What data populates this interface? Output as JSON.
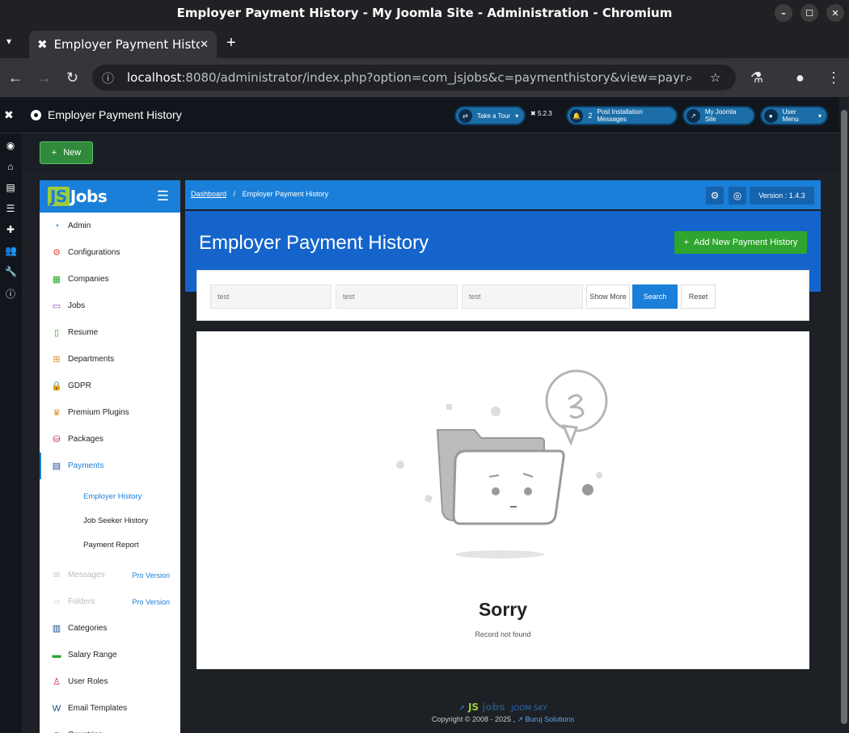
{
  "window": {
    "title": "Employer Payment History - My Joomla Site - Administration - Chromium"
  },
  "browser": {
    "tab_title": "Employer Payment History - My Joomla Site - Administration",
    "url_host": "localhost",
    "url_rest": ":8080/administrator/index.php?option=com_jsjobs&c=paymenthistory&view=paymenthistory&la..."
  },
  "joomla_header": {
    "page_title": "Employer Payment History",
    "take_tour": "Take a Tour",
    "version": "5.2.3",
    "messages_count": "2",
    "post_install": "Post Installation Messages",
    "my_site": "My Joomla Site",
    "user_menu": "User Menu"
  },
  "toolbar": {
    "new_label": "New"
  },
  "sidebar": {
    "brand": "Jobs",
    "brand_prefix": "JS",
    "items": [
      {
        "label": "Admin",
        "icon": "dashboard-icon",
        "color": "#1a7fd8"
      },
      {
        "label": "Configurations",
        "icon": "gear-icon",
        "color": "#e0503a"
      },
      {
        "label": "Companies",
        "icon": "building-icon",
        "color": "#2ea52e"
      },
      {
        "label": "Jobs",
        "icon": "briefcase-icon",
        "color": "#8a44b8"
      },
      {
        "label": "Resume",
        "icon": "resume-icon",
        "color": "#2ea52e"
      },
      {
        "label": "Departments",
        "icon": "departments-icon",
        "color": "#e08a1a"
      },
      {
        "label": "GDPR",
        "icon": "lock-icon",
        "color": "#e0a81a"
      },
      {
        "label": "Premium Plugins",
        "icon": "crown-icon",
        "color": "#e08a1a"
      },
      {
        "label": "Packages",
        "icon": "packages-icon",
        "color": "#c2185b"
      },
      {
        "label": "Payments",
        "icon": "payments-icon",
        "color": "#1a4a8a"
      }
    ],
    "sub_items": [
      {
        "label": "Employer History"
      },
      {
        "label": "Job Seeker History"
      },
      {
        "label": "Payment Report"
      }
    ],
    "items_after": [
      {
        "label": "Messages",
        "icon": "mail-icon",
        "pro": "Pro Version"
      },
      {
        "label": "Folders",
        "icon": "folder-icon",
        "pro": "Pro Version"
      },
      {
        "label": "Categories",
        "icon": "categories-icon",
        "color": "#1a4a8a"
      },
      {
        "label": "Salary Range",
        "icon": "salary-icon",
        "color": "#2ea52e"
      },
      {
        "label": "User Roles",
        "icon": "user-roles-icon",
        "color": "#c2185b"
      },
      {
        "label": "Email Templates",
        "icon": "email-template-icon",
        "color": "#1a4a8a"
      },
      {
        "label": "Countries",
        "icon": "globe-icon",
        "color": "#2ea52e"
      }
    ]
  },
  "breadcrumb": {
    "home": "Dashboard",
    "current": "Employer Payment History"
  },
  "main": {
    "version_badge": "Version : 1.4.3",
    "heading": "Employer Payment History",
    "add_button": "Add New Payment History"
  },
  "filters": {
    "input1": "test",
    "input2": "test",
    "input3": "test",
    "show_more": "Show More",
    "search": "Search",
    "reset": "Reset"
  },
  "empty_state": {
    "title": "Sorry",
    "message": "Record not found"
  },
  "footer": {
    "logo_js": "JS",
    "logo_jobs": "jobs",
    "logo_joom": "JOOM SKY",
    "copyright": "Copyright © 2008 - 2025 ,",
    "company": "Buruj Solutions"
  }
}
